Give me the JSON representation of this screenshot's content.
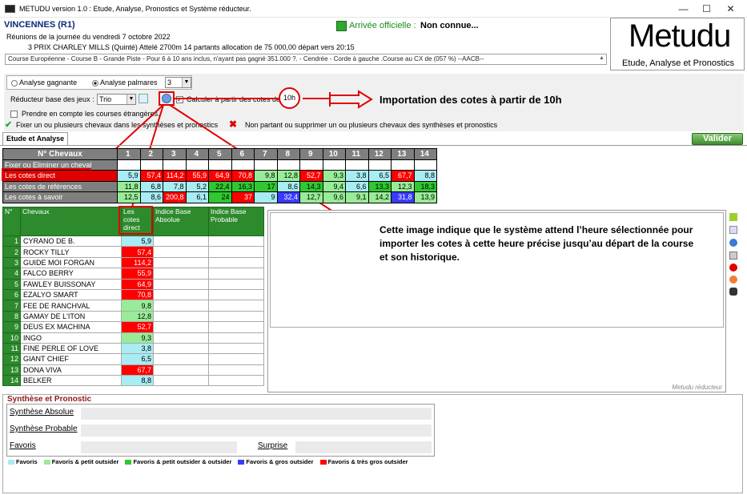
{
  "window": {
    "title": "METUDU version 1.0  : Etude, Analyse,  Pronostics et Système réducteur.",
    "min": "—",
    "max": "☐",
    "close": "✕"
  },
  "race": {
    "title": "VINCENNES (R1)",
    "arrivee_label": "Arrivée officielle :",
    "arrivee_value": "Non connue...",
    "line1": "Réunions de la journée du vendredi 7 octobre 2022",
    "line2": "3 PRIX CHARLEY MILLS (Quinté) Attelé 2700m 14 partants allocation de 75 000,00 départ vers 20:15",
    "desc": "Course Européenne - Course B - Grande Piste - Pour 6 à 10 ans inclus, n'ayant pas gagné 351.000 ?. - Cendrée - Corde à gauche .Course au CX de (057 %) --AACB--"
  },
  "logo": {
    "big": "Metudu",
    "sub": "Etude, Analyse et Pronostics"
  },
  "options": {
    "radio1": "Analyse gagnante",
    "radio2": "Analyse palmares",
    "palmares_count": "3",
    "reducteur_label": "Réducteur base des jeux :",
    "reducteur_value": "Trio",
    "calc_label": "Calculer à partir des cotes de",
    "calc_hour": "10h",
    "etrangeres": "Prendre en compte les courses étrangères.",
    "fixer": "Fixer un ou plusieurs chevaux dans les synthèses et pronostics",
    "non_partant": "Non partant ou supprimer un ou plusieurs chevaux des synthèses et pronostics"
  },
  "annot": {
    "note1": "Importation des cotes à partir de 10h",
    "note2": "Cette image indique que le système attend l’heure sélectionnée pour importer les cotes à cette heure précise jusqu’au départ de la course et son historique."
  },
  "tab": "Etude et Analyse",
  "valider": "Valider",
  "grid": {
    "header": "N° Chevaux",
    "numbers": [
      "1",
      "2",
      "3",
      "4",
      "5",
      "6",
      "7",
      "8",
      "9",
      "10",
      "11",
      "12",
      "13",
      "14"
    ],
    "rows": [
      {
        "label": "Fixer ou Eliminer un cheval",
        "values": [
          "",
          "",
          "",
          "",
          "",
          "",
          "",
          "",
          "",
          "",
          "",
          "",
          "",
          ""
        ]
      },
      {
        "label": "Les cotes direct",
        "values": [
          "5,9",
          "57,4",
          "114,2",
          "55,9",
          "64,9",
          "70,8",
          "9,8",
          "12,8",
          "52,7",
          "9,3",
          "3,8",
          "6,5",
          "67,7",
          "8,8"
        ],
        "colors": [
          "#a8ecf4",
          "#ff0000",
          "#ff0000",
          "#ff0000",
          "#ff0000",
          "#ff0000",
          "#98ec98",
          "#98ec98",
          "#ff0000",
          "#98ec98",
          "#a8ecf4",
          "#a8ecf4",
          "#ff0000",
          "#a8ecf4"
        ]
      },
      {
        "label": "Les cotes de références",
        "values": [
          "11,8",
          "6,8",
          "7,8",
          "5,2",
          "22,4",
          "16,3",
          "17",
          "8,6",
          "14,3",
          "9,4",
          "6,6",
          "13,3",
          "12,3",
          "18,3"
        ],
        "colors": [
          "#98ec98",
          "#a8ecf4",
          "#a8ecf4",
          "#a8ecf4",
          "#30c830",
          "#30c830",
          "#30c830",
          "#a8ecf4",
          "#30c830",
          "#98ec98",
          "#a8ecf4",
          "#30c830",
          "#98ec98",
          "#30c830"
        ]
      },
      {
        "label": "Les cotes à savoir",
        "values": [
          "12,5",
          "8,6",
          "200,8",
          "6,1",
          "24",
          "37",
          "9",
          "32,4",
          "12,7",
          "9,6",
          "9,1",
          "14,2",
          "31,8",
          "13,9"
        ],
        "colors": [
          "#98ec98",
          "#a8ecf4",
          "#ff0000",
          "#a8ecf4",
          "#30c830",
          "#ff0000",
          "#a8ecf4",
          "#3a3aff",
          "#98ec98",
          "#98ec98",
          "#98ec98",
          "#98ec98",
          "#3a3aff",
          "#98ec98"
        ]
      }
    ]
  },
  "list": {
    "h_n": "N°",
    "h_nom": "Chevaux",
    "h_cote": "Les cotes direct",
    "h_abs": "Indice Base Absolue",
    "h_prob": "Indice Base Probable",
    "horses": [
      {
        "n": "1",
        "name": "CYRANO DE B.",
        "cote": "5,9",
        "color": "#a8ecf4"
      },
      {
        "n": "2",
        "name": "ROCKY TILLY",
        "cote": "57,4",
        "color": "#ff0000"
      },
      {
        "n": "3",
        "name": "GUIDE MOI FORGAN",
        "cote": "114,2",
        "color": "#ff0000"
      },
      {
        "n": "4",
        "name": "FALCO BERRY",
        "cote": "55,9",
        "color": "#ff0000"
      },
      {
        "n": "5",
        "name": "FAWLEY BUISSONAY",
        "cote": "64,9",
        "color": "#ff0000"
      },
      {
        "n": "6",
        "name": "EZALYO SMART",
        "cote": "70,8",
        "color": "#ff0000"
      },
      {
        "n": "7",
        "name": "FEE DE RANCHVAL",
        "cote": "9,8",
        "color": "#98ec98"
      },
      {
        "n": "8",
        "name": "GAMAY DE L'ITON",
        "cote": "12,8",
        "color": "#98ec98"
      },
      {
        "n": "9",
        "name": "DEUS EX MACHINA",
        "cote": "52,7",
        "color": "#ff0000"
      },
      {
        "n": "10",
        "name": "INGO",
        "cote": "9,3",
        "color": "#98ec98"
      },
      {
        "n": "11",
        "name": "FINE PERLE OF LOVE",
        "cote": "3,8",
        "color": "#a8ecf4"
      },
      {
        "n": "12",
        "name": "GIANT CHIEF",
        "cote": "6,5",
        "color": "#a8ecf4"
      },
      {
        "n": "13",
        "name": "DONA VIVA",
        "cote": "67,7",
        "color": "#ff0000"
      },
      {
        "n": "14",
        "name": "BELKER",
        "cote": "8,8",
        "color": "#a8ecf4"
      }
    ]
  },
  "panel_footer": "Metudu réducteur",
  "synthese": {
    "title": "Synthèse et Pronostic",
    "absolue": "Synthèse Absolue",
    "probable": "Synthèse Probable",
    "favoris": "Favoris",
    "surprise": "Surprise"
  },
  "legend": [
    {
      "label": "Favoris",
      "color": "#a8ecf4"
    },
    {
      "label": "Favoris & petit outsider",
      "color": "#98ec98"
    },
    {
      "label": "Favoris & petit outsider & outsider",
      "color": "#30c830"
    },
    {
      "label": "Favoris & gros outsider",
      "color": "#3a3aff"
    },
    {
      "label": "Favoris & très gros outsider",
      "color": "#ff0000"
    }
  ]
}
